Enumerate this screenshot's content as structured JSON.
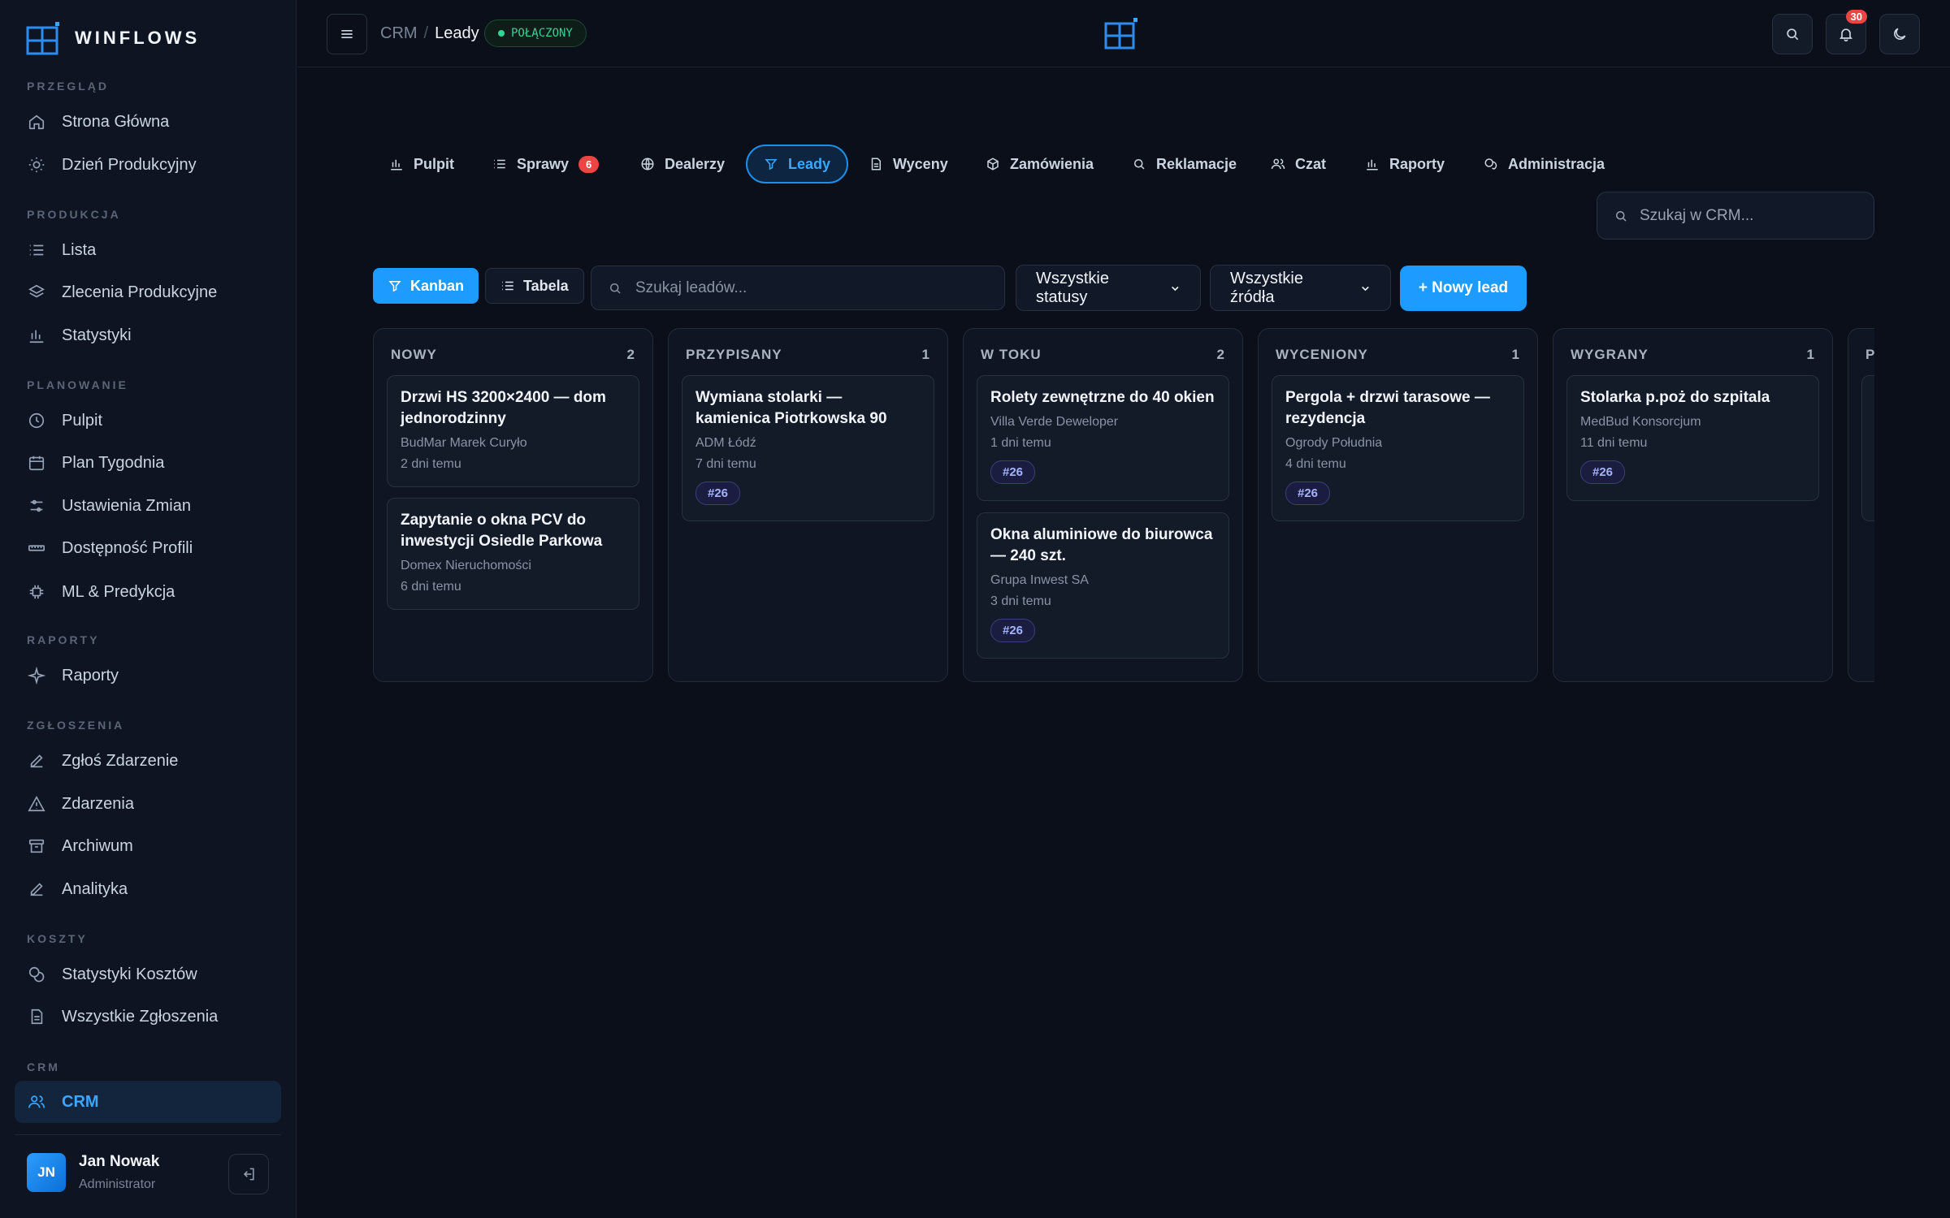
{
  "brand": {
    "name": "WINFLOWS"
  },
  "sidebar": {
    "sections": [
      {
        "label": "PRZEGLĄD",
        "items": [
          "Strona Główna",
          "Dzień Produkcyjny"
        ]
      },
      {
        "label": "PRODUKCJA",
        "items": [
          "Lista",
          "Zlecenia Produkcyjne",
          "Statystyki"
        ]
      },
      {
        "label": "PLANOWANIE",
        "items": [
          "Pulpit",
          "Plan Tygodnia",
          "Ustawienia Zmian",
          "Dostępność Profili",
          "ML & Predykcja"
        ]
      },
      {
        "label": "RAPORTY",
        "items": [
          "Raporty"
        ]
      },
      {
        "label": "ZGŁOSZENIA",
        "items": [
          "Zgłoś Zdarzenie",
          "Zdarzenia",
          "Archiwum",
          "Analityka"
        ]
      },
      {
        "label": "KOSZTY",
        "items": [
          "Statystyki Kosztów",
          "Wszystkie Zgłoszenia"
        ]
      },
      {
        "label": "CRM",
        "items": [
          "CRM"
        ]
      }
    ],
    "active_item": "CRM",
    "user": {
      "initials": "JN",
      "name": "Jan Nowak",
      "role": "Administrator"
    }
  },
  "topbar": {
    "breadcrumb": [
      "CRM",
      "/",
      "Leady"
    ],
    "connection_status": "POŁĄCZONY",
    "notifications_count": "30"
  },
  "tabs": [
    {
      "label": "Pulpit",
      "icon": "bar-chart-icon"
    },
    {
      "label": "Sprawy",
      "icon": "list-icon",
      "badge": "6"
    },
    {
      "label": "Dealerzy",
      "icon": "globe-icon"
    },
    {
      "label": "Leady",
      "icon": "filter-icon",
      "active": true
    },
    {
      "label": "Wyceny",
      "icon": "document-icon"
    },
    {
      "label": "Zamówienia",
      "icon": "box-icon"
    },
    {
      "label": "Reklamacje",
      "icon": "search-icon"
    },
    {
      "label": "Czat",
      "icon": "users-icon"
    },
    {
      "label": "Raporty",
      "icon": "bar-chart-icon"
    },
    {
      "label": "Administracja",
      "icon": "chat-icon"
    }
  ],
  "crm_search": {
    "placeholder": "Szukaj w CRM..."
  },
  "toolbar": {
    "kanban_label": "Kanban",
    "table_label": "Tabela",
    "lead_search_placeholder": "Szukaj leadów...",
    "status_select": "Wszystkie statusy",
    "source_select": "Wszystkie źródła",
    "new_lead_label": "+ Nowy lead"
  },
  "columns": [
    {
      "title": "NOWY",
      "count": "2",
      "cards": [
        {
          "title": "Drzwi HS 3200×2400 — dom jednorodzinny",
          "company": "BudMar Marek Curyło",
          "time": "2 dni temu"
        },
        {
          "title": "Zapytanie o okna PCV do inwestycji Osiedle Parkowa",
          "company": "Domex Nieruchomości",
          "time": "6 dni temu"
        }
      ]
    },
    {
      "title": "PRZYPISANY",
      "count": "1",
      "cards": [
        {
          "title": "Wymiana stolarki — kamienica Piotrkowska 90",
          "company": "ADM Łódź",
          "time": "7 dni temu",
          "tag": "#26"
        }
      ]
    },
    {
      "title": "W TOKU",
      "count": "2",
      "cards": [
        {
          "title": "Rolety zewnętrzne do 40 okien",
          "company": "Villa Verde Deweloper",
          "time": "1 dni temu",
          "tag": "#26"
        },
        {
          "title": "Okna aluminiowe do biurowca — 240 szt.",
          "company": "Grupa Inwest SA",
          "time": "3 dni temu",
          "tag": "#26"
        }
      ]
    },
    {
      "title": "WYCENIONY",
      "count": "1",
      "cards": [
        {
          "title": "Pergola + drzwi tarasowe — rezydencja",
          "company": "Ogrody Południa",
          "time": "4 dni temu",
          "tag": "#26"
        }
      ]
    },
    {
      "title": "WYGRANY",
      "count": "1",
      "cards": [
        {
          "title": "Stolarka p.poż do szpitala",
          "company": "MedBud Konsorcjum",
          "time": "11 dni temu",
          "tag": "#26"
        }
      ]
    },
    {
      "title": "P",
      "count": "",
      "cards": []
    }
  ],
  "colors": {
    "accent": "#1e9bff",
    "background": "#0b0f19",
    "success": "#34d399",
    "danger": "#ef4444"
  }
}
